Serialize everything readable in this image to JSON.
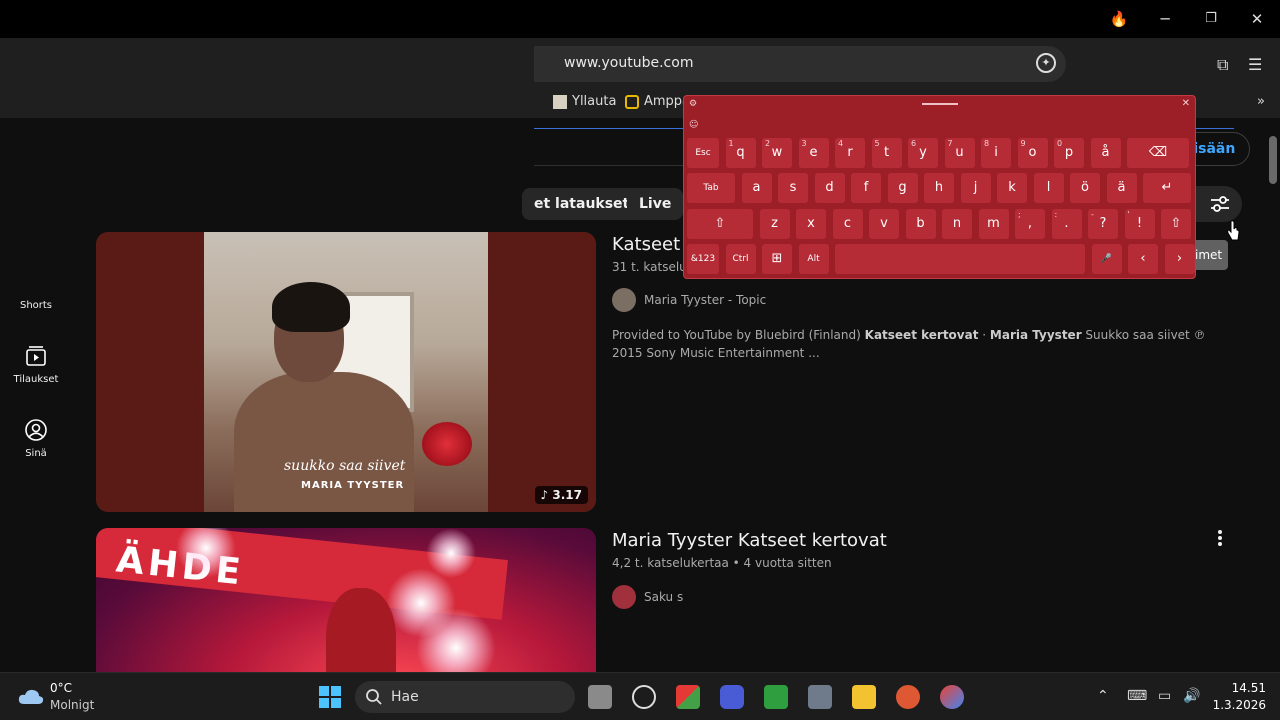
{
  "browser": {
    "url": "www.youtube.com",
    "bookmarks": [
      {
        "label": "Yllauta"
      },
      {
        "label": "Amppa"
      }
    ]
  },
  "youtube": {
    "signin_label": "sisään",
    "chips": [
      "et lataukset",
      "Live"
    ],
    "filter_label": "t",
    "tooltip": "imet",
    "sidebar": [
      {
        "label": "Shorts"
      },
      {
        "label": "Tilaukset"
      },
      {
        "label": "Sinä"
      }
    ],
    "videos": [
      {
        "title": "Katseet k",
        "meta": "31 t. katseluk",
        "channel": "Maria Tyyster - Topic",
        "description_prefix": "Provided to YouTube by Bluebird (Finland) ",
        "description_bold1": "Katseet kertovat",
        "description_mid": " · ",
        "description_bold2": "Maria Tyyster",
        "description_suffix": " Suukko saa siivet ℗ 2015 Sony Music Entertainment ...",
        "duration": "3.17",
        "thumb_script": "suukko saa siivet",
        "thumb_artist": "MARIA TYYSTER"
      },
      {
        "title": "Maria Tyyster Katseet kertovat",
        "meta": "4,2 t. katselukertaa • 4 vuotta sitten",
        "channel": "Saku s",
        "thumb_banner": "ÄHDE"
      }
    ]
  },
  "keyboard": {
    "row1": [
      {
        "k": "Esc"
      },
      {
        "k": "q",
        "s": "1"
      },
      {
        "k": "w",
        "s": "2"
      },
      {
        "k": "e",
        "s": "3"
      },
      {
        "k": "r",
        "s": "4"
      },
      {
        "k": "t",
        "s": "5"
      },
      {
        "k": "y",
        "s": "6"
      },
      {
        "k": "u",
        "s": "7"
      },
      {
        "k": "i",
        "s": "8"
      },
      {
        "k": "o",
        "s": "9"
      },
      {
        "k": "p",
        "s": "0"
      },
      {
        "k": "å"
      },
      {
        "k": "⌫"
      }
    ],
    "row2": [
      {
        "k": "Tab"
      },
      {
        "k": "a"
      },
      {
        "k": "s"
      },
      {
        "k": "d"
      },
      {
        "k": "f"
      },
      {
        "k": "g"
      },
      {
        "k": "h"
      },
      {
        "k": "j"
      },
      {
        "k": "k"
      },
      {
        "k": "l"
      },
      {
        "k": "ö"
      },
      {
        "k": "ä"
      },
      {
        "k": "↵"
      }
    ],
    "row3": [
      {
        "k": "⇧"
      },
      {
        "k": "z"
      },
      {
        "k": "x"
      },
      {
        "k": "c"
      },
      {
        "k": "v"
      },
      {
        "k": "b"
      },
      {
        "k": "n"
      },
      {
        "k": "m"
      },
      {
        "k": ",",
        "s": ";"
      },
      {
        "k": ".",
        "s": ":"
      },
      {
        "k": "?",
        "s": "-"
      },
      {
        "k": "!",
        "s": "'"
      },
      {
        "k": "⇧"
      }
    ],
    "row4": [
      {
        "k": "&123"
      },
      {
        "k": "Ctrl"
      },
      {
        "k": "⊞"
      },
      {
        "k": "Alt"
      },
      {
        "k": ""
      },
      {
        "k": "🎤"
      },
      {
        "k": "‹"
      },
      {
        "k": "›"
      }
    ]
  },
  "taskbar": {
    "weather_temp": "0°C",
    "weather_desc": "Molnigt",
    "search_placeholder": "Hae",
    "time": "14.51",
    "date": "1.3.2026"
  }
}
